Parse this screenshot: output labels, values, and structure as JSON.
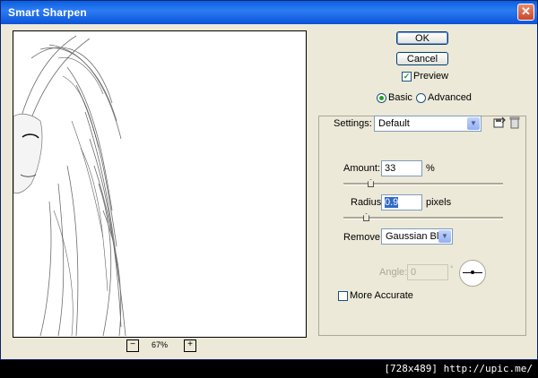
{
  "window": {
    "title": "Smart Sharpen",
    "close_glyph": "✕"
  },
  "zoom": {
    "minus": "−",
    "value": "67%",
    "plus": "+"
  },
  "buttons": {
    "ok": "OK",
    "cancel": "Cancel"
  },
  "preview_toggle": {
    "label": "Preview",
    "checked": true
  },
  "mode": {
    "basic": "Basic",
    "advanced": "Advanced",
    "selected": "basic"
  },
  "settings": {
    "label": "Settings:",
    "value": "Default",
    "save_icon": "save-settings-icon",
    "delete_icon": "trash-icon"
  },
  "amount": {
    "label": "Amount:",
    "value": "33",
    "unit": "%"
  },
  "radius": {
    "label": "Radius:",
    "value_selected": "0.9",
    "unit": "pixels"
  },
  "remove": {
    "label": "Remove:",
    "value": "Gaussian Blur"
  },
  "angle": {
    "label": "Angle:",
    "value": "0",
    "unit": "°"
  },
  "more_accurate": {
    "label": "More Accurate",
    "checked": false
  },
  "footer": {
    "text": "[728x489] http://upic.me/"
  }
}
